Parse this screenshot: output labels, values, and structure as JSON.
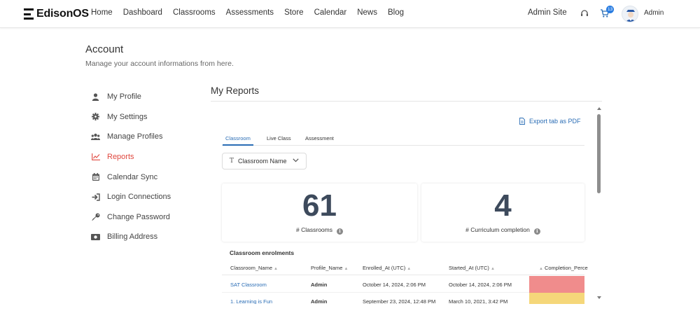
{
  "brand": {
    "name": "EdisonOS"
  },
  "nav": {
    "links": [
      "Home",
      "Dashboard",
      "Classrooms",
      "Assessments",
      "Store",
      "Calendar",
      "News",
      "Blog"
    ],
    "admin_site": "Admin Site",
    "cart_count": "13",
    "user_name": "Admin"
  },
  "account": {
    "title": "Account",
    "subtitle": "Manage your account informations from here."
  },
  "sidebar": {
    "items": [
      {
        "label": "My Profile",
        "icon": "user-icon"
      },
      {
        "label": "My Settings",
        "icon": "gear-icon"
      },
      {
        "label": "Manage Profiles",
        "icon": "users-icon"
      },
      {
        "label": "Reports",
        "icon": "chart-line-icon",
        "active": true
      },
      {
        "label": "Calendar Sync",
        "icon": "calendar-icon"
      },
      {
        "label": "Login Connections",
        "icon": "sign-in-icon"
      },
      {
        "label": "Change Password",
        "icon": "key-icon"
      },
      {
        "label": "Billing Address",
        "icon": "money-bill-icon"
      }
    ]
  },
  "reports": {
    "title": "My Reports",
    "export_label": "Export tab as PDF",
    "tabs": [
      "Classroom",
      "Live Class",
      "Assessment"
    ],
    "active_tab": "Classroom",
    "column_select": "Classroom Name",
    "cards": [
      {
        "value": "61",
        "label": "# Classrooms"
      },
      {
        "value": "4",
        "label": "# Curriculum completion"
      }
    ],
    "table": {
      "title": "Classroom enrolments",
      "headers": [
        "Classroom_Name",
        "Profile_Name",
        "Enrolled_At (UTC)",
        "Started_At (UTC)",
        "Completion_Perce"
      ],
      "rows": [
        {
          "classroom": "SAT Classroom",
          "profile": "Admin",
          "enrolled": "October 14, 2024, 2:06 PM",
          "started": "October 14, 2024, 2:06 PM",
          "heat_color": "#f08c8c"
        },
        {
          "classroom": "1. Learning is Fun",
          "profile": "Admin",
          "enrolled": "September 23, 2024, 12:48 PM",
          "started": "March 10, 2021, 3:42 PM",
          "heat_color": "#f5d77a"
        }
      ]
    }
  }
}
